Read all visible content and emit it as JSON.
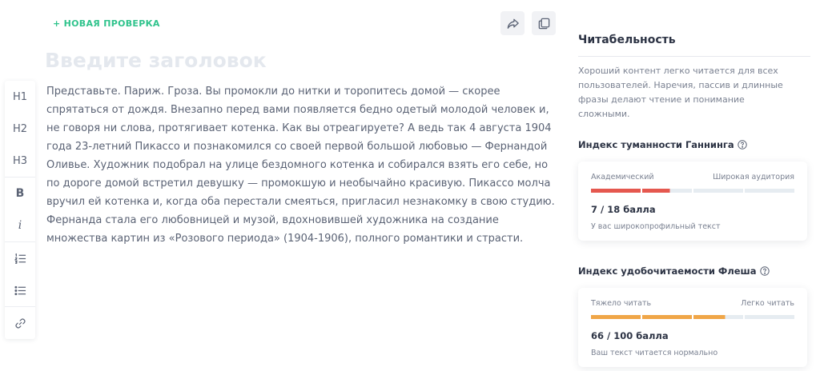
{
  "editor": {
    "new_check_label": "+ НОВАЯ ПРОВЕРКА",
    "title_placeholder": "Введите заголовок",
    "title_value": "",
    "body": "Представьте. Париж. Гроза. Вы промокли до нитки и торопитесь домой — скорее спрятаться от дождя. Внезапно перед вами появляется бедно одетый молодой человек и, не говоря ни слова, протягивает котенка. Как вы отреагируете? А ведь так 4 августа 1904 года 23-летний Пикассо и познакомился со своей первой большой любовью — Фернандой Оливье. Художник подобрал на улице бездомного котенка и собирался взять его себе, но по дороге домой встретил девушку — промокшую и необычайно красивую. Пикассо молча вручил ей котенка и, когда оба перестали смеяться, пригласил незнакомку в свою студию. Фернанда стала его любовницей и музой, вдохновившей художника на создание множества картин из «Розового периода» (1904-1906), полного романтики и страсти.",
    "share_icon": "share-icon",
    "copy_icon": "copy-icon"
  },
  "toolbar": {
    "h1": "H1",
    "h2": "H2",
    "h3": "H3",
    "bold": "B",
    "italic": "i",
    "icons": [
      "ordered-list-icon",
      "bullet-list-icon",
      "link-icon"
    ]
  },
  "readability": {
    "title": "Читабельность",
    "description": "Хороший контент легко читается для всех пользователей. Наречия, пассив и длинные фразы делают чтение и понимание сложными.",
    "gunning": {
      "title": "Индекс туманности Ганнинга",
      "left_label": "Академический",
      "right_label": "Широкая аудитория",
      "score": "7 / 18 балла",
      "score_value": 7,
      "score_max": 18,
      "verdict": "У вас широкопрофильный текст",
      "color": "#e5584f"
    },
    "flesch": {
      "title": "Индекс удобочитаемости Флеша",
      "left_label": "Тяжело читать",
      "right_label": "Легко читать",
      "score": "66 / 100 балла",
      "score_value": 66,
      "score_max": 100,
      "verdict": "Ваш текст читается нормально",
      "color": "#f0a648"
    }
  },
  "colors": {
    "accent_green": "#2fc38c",
    "track": "#e6ecf1"
  }
}
